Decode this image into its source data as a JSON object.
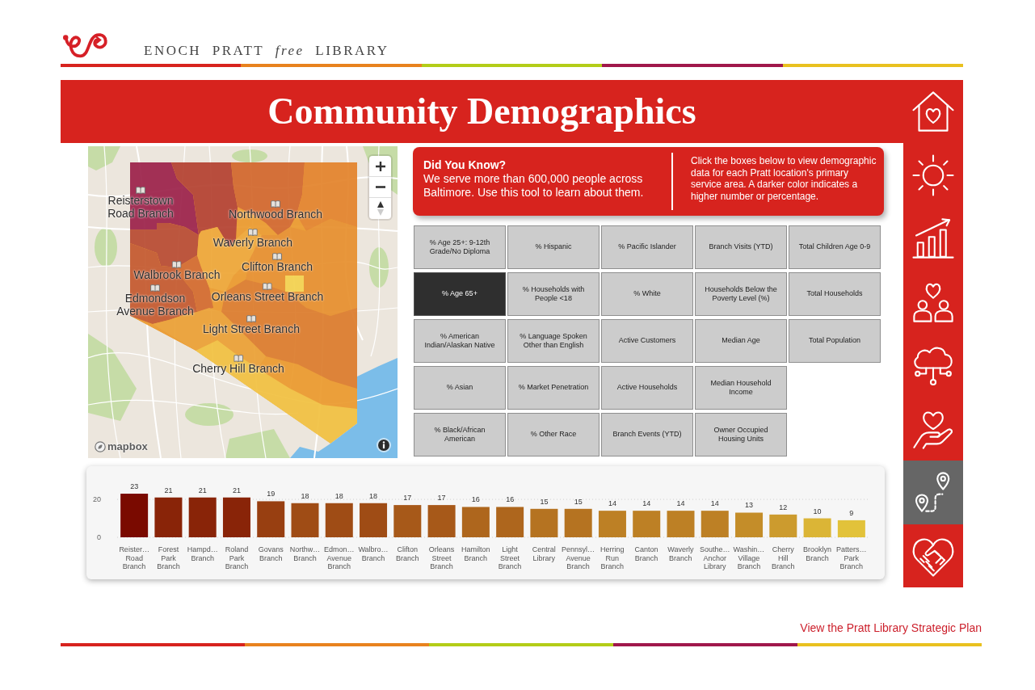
{
  "header": {
    "brand": "ENOCH PRATT *free* LIBRARY"
  },
  "title": "Community Demographics",
  "map": {
    "labels": [
      "Reisterstown Road Branch",
      "Northwood Branch",
      "Waverly Branch",
      "Clifton Branch",
      "Walbrook Branch",
      "Edmondson Avenue Branch",
      "Orleans Street Branch",
      "Light Street Branch",
      "Cherry Hill Branch"
    ],
    "attribution": "mapbox"
  },
  "info": {
    "heading": "Did You Know?",
    "text": "We serve more than 600,000 people across Baltimore. Use this tool to learn about them.",
    "instructions": "Click the boxes below to view demographic data for each Pratt location's primary service area. A darker color indicates a higher number or percentage."
  },
  "metrics": [
    {
      "label": "% Age 25+: 9-12th Grade/No Diploma",
      "selected": false
    },
    {
      "label": "% Age 65+",
      "selected": true
    },
    {
      "label": "% American Indian/Alaskan Native",
      "selected": false
    },
    {
      "label": "% Asian",
      "selected": false
    },
    {
      "label": "% Black/African American",
      "selected": false
    },
    {
      "label": "% Hispanic",
      "selected": false
    },
    {
      "label": "% Households with People <18",
      "selected": false
    },
    {
      "label": "% Language Spoken Other than English",
      "selected": false
    },
    {
      "label": "% Market Penetration",
      "selected": false
    },
    {
      "label": "% Other Race",
      "selected": false
    },
    {
      "label": "% Pacific Islander",
      "selected": false
    },
    {
      "label": "% White",
      "selected": false
    },
    {
      "label": "Active Customers",
      "selected": false
    },
    {
      "label": "Active Households",
      "selected": false
    },
    {
      "label": "Branch Events (YTD)",
      "selected": false
    },
    {
      "label": "Branch Visits (YTD)",
      "selected": false
    },
    {
      "label": "Households Below the Poverty Level (%)",
      "selected": false
    },
    {
      "label": "Median Age",
      "selected": false
    },
    {
      "label": "Median Household Income",
      "selected": false
    },
    {
      "label": "Owner Occupied Housing Units",
      "selected": false
    },
    {
      "label": "Total Children Age 0-9",
      "selected": false
    },
    {
      "label": "Total Households",
      "selected": false
    },
    {
      "label": "Total Population",
      "selected": false
    }
  ],
  "chart": {
    "chart_data": {
      "type": "bar",
      "categories": [
        "Reister… Road Branch",
        "Forest Park Branch",
        "Hampd… Branch",
        "Roland Park Branch",
        "Govans Branch",
        "Northw… Branch",
        "Edmon… Avenue Branch",
        "Walbro… Branch",
        "Clifton Branch",
        "Orleans Street Branch",
        "Hamilton Branch",
        "Light Street Branch",
        "Central Library",
        "Pennsyl… Avenue Branch",
        "Herring Run Branch",
        "Canton Branch",
        "Waverly Branch",
        "Southe… Anchor Library",
        "Washin… Village Branch",
        "Cherry Hill Branch",
        "Brooklyn Branch",
        "Patters… Park Branch"
      ],
      "values": [
        23,
        21,
        21,
        21,
        19,
        18,
        18,
        18,
        17,
        17,
        16,
        16,
        15,
        15,
        14,
        14,
        14,
        14,
        13,
        12,
        10,
        9
      ],
      "ylim": [
        0,
        37.5
      ],
      "yticks": [
        0,
        20
      ],
      "data_labels": true
    }
  },
  "sidebar": {
    "items": [
      {
        "selected": false
      },
      {
        "selected": false
      },
      {
        "selected": false
      },
      {
        "selected": false
      },
      {
        "selected": false
      },
      {
        "selected": false
      },
      {
        "selected": true
      },
      {
        "selected": false
      }
    ]
  },
  "footer": {
    "link": "View the Pratt Library Strategic Plan"
  }
}
